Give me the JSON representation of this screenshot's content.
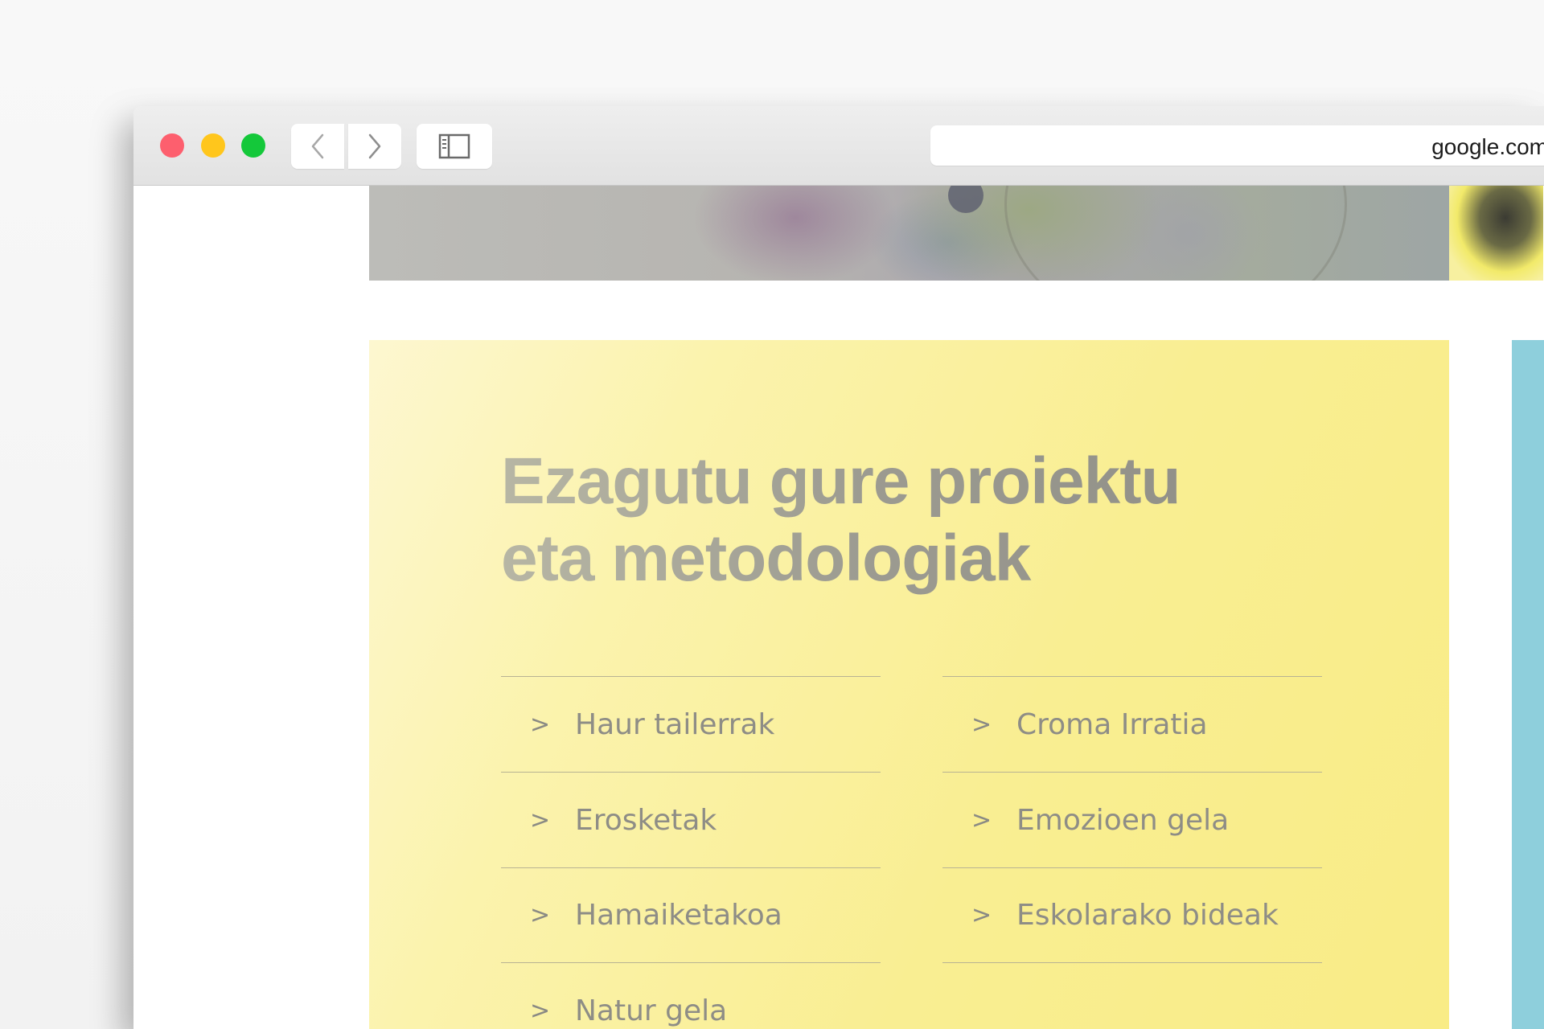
{
  "browser": {
    "url": "google.com"
  },
  "icons": {
    "back": "chevron-left-icon",
    "forward": "chevron-right-icon",
    "sidebar": "sidebar-icon"
  },
  "colors": {
    "close": "#fd5f6e",
    "minimize": "#ffc61c",
    "maximize": "#14c83a",
    "card_background": "#f9ee92",
    "side_card": "#8ecfdc"
  },
  "card": {
    "title_line1": "Ezagutu gure proiektu",
    "title_line2": "eta metodologiak",
    "left_items": [
      {
        "label": "Haur tailerrak"
      },
      {
        "label": "Erosketak"
      },
      {
        "label": "Hamaiketakoa"
      },
      {
        "label": "Natur gela"
      }
    ],
    "right_items": [
      {
        "label": "Croma Irratia"
      },
      {
        "label": "Emozioen gela"
      },
      {
        "label": "Eskolarako bideak"
      }
    ],
    "chevron": ">"
  }
}
